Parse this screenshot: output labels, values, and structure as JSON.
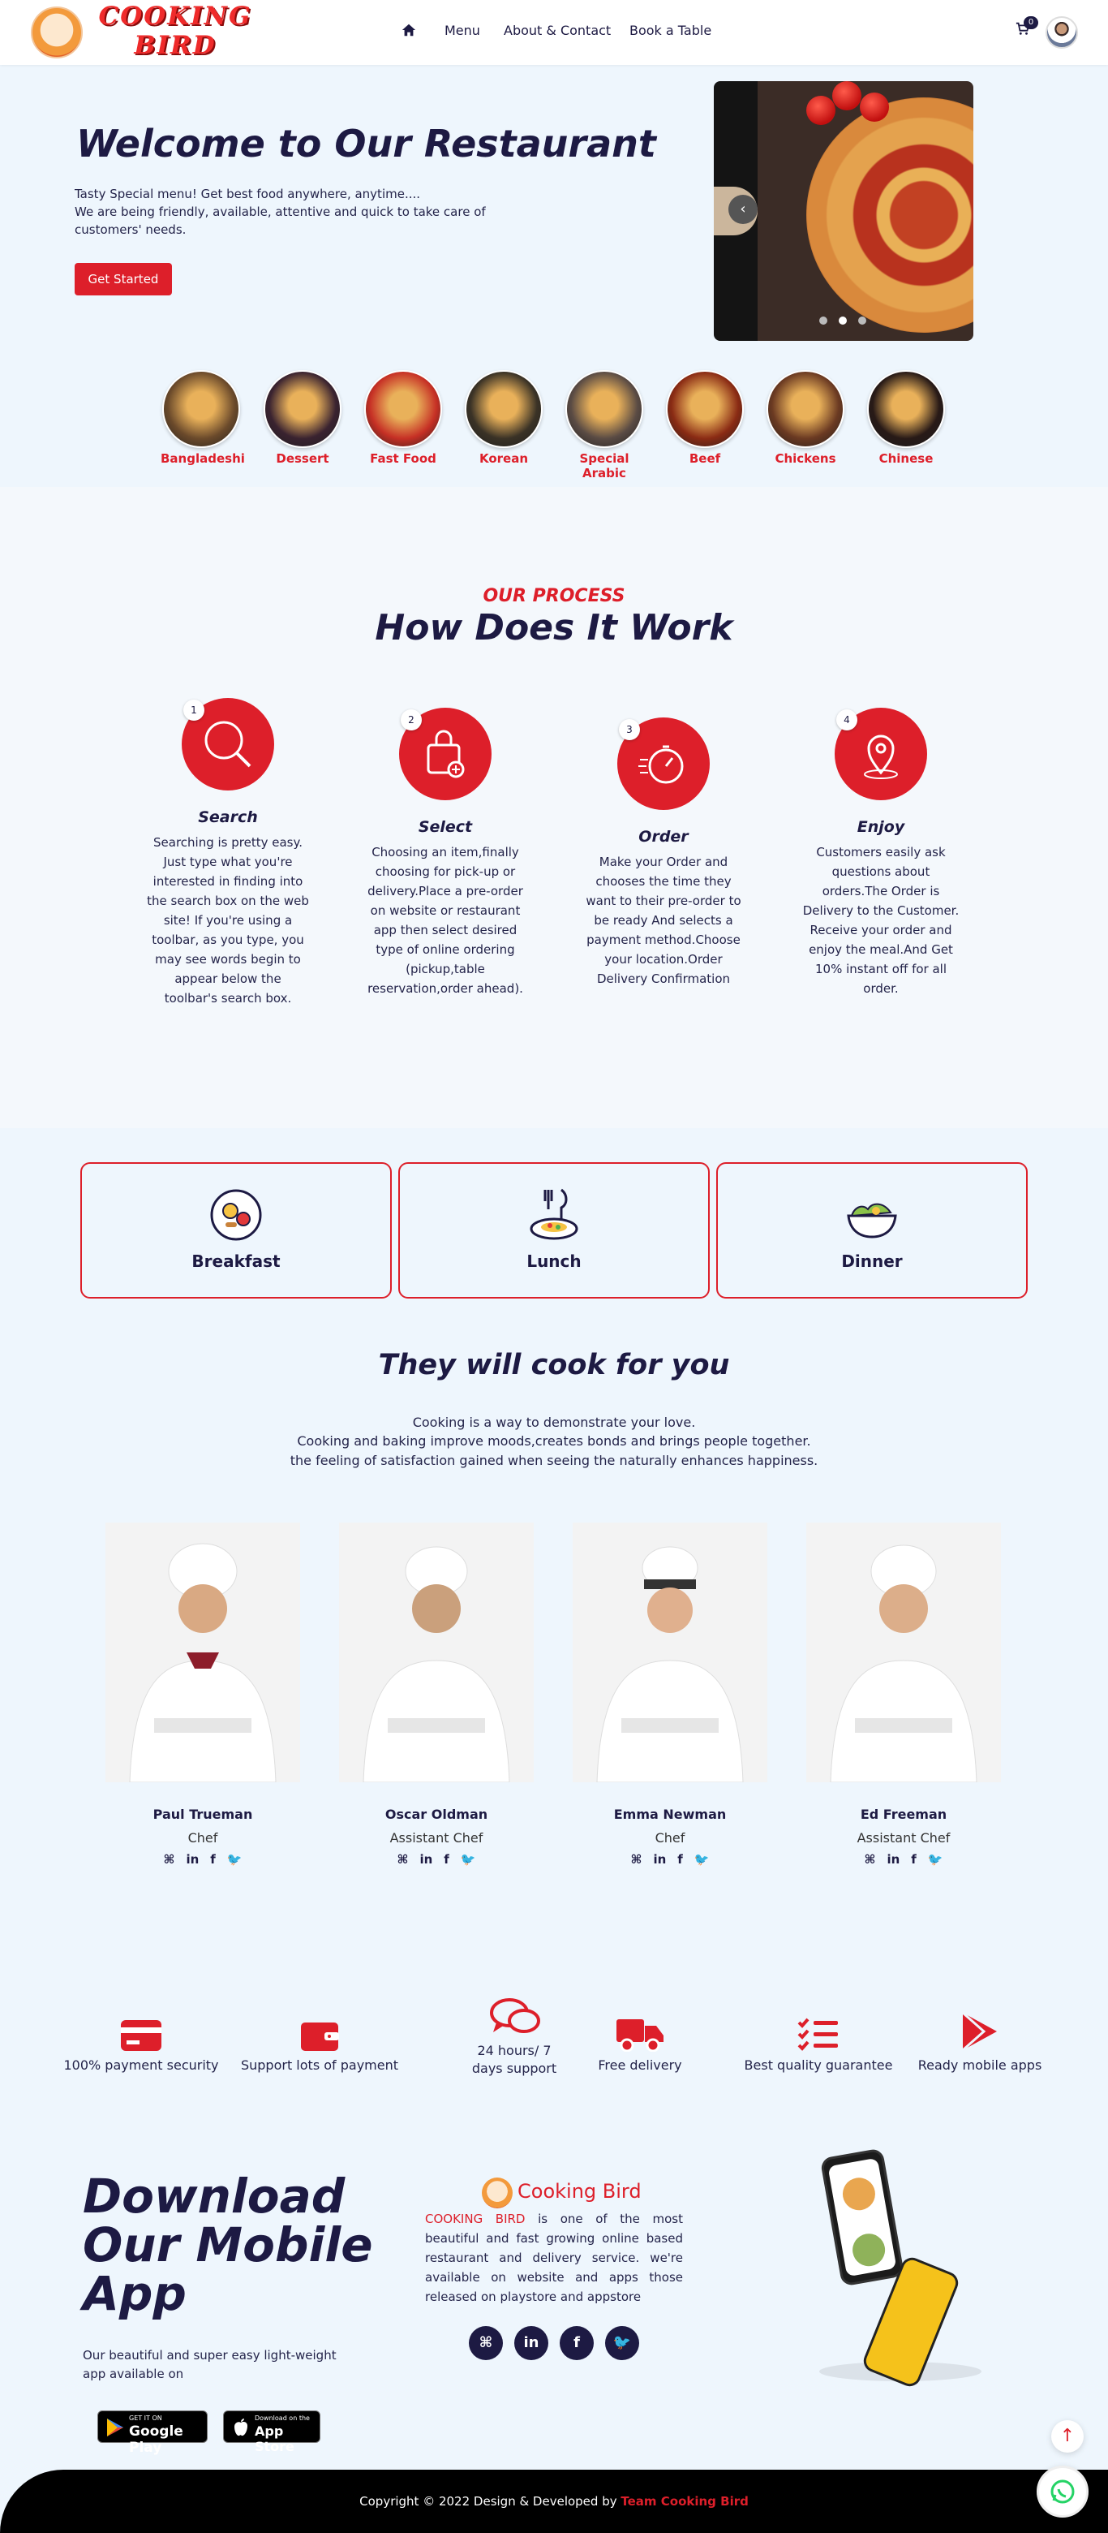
{
  "header": {
    "logo_text_line1": "COOKING",
    "logo_text_line2": "BIRD",
    "nav": [
      {
        "label": "Menu"
      },
      {
        "label": "About & Contact"
      },
      {
        "label": "Book a Table"
      }
    ],
    "cart_count": "0"
  },
  "hero": {
    "title": "Welcome to Our Restaurant",
    "line1": "Tasty Special menu! Get best food anywhere, anytime....",
    "line2": "We are being friendly, available, attentive and quick to take care of",
    "line3": "customers' needs.",
    "cta": "Get Started",
    "slider_prev": "‹"
  },
  "categories": [
    {
      "label": "Bangladeshi",
      "color": "#6b4a2b"
    },
    {
      "label": "Dessert",
      "color": "#3a2330"
    },
    {
      "label": "Fast Food",
      "color": "#c63025"
    },
    {
      "label": "Korean",
      "color": "#3a3226"
    },
    {
      "label": "Special Arabic",
      "color": "#5a4b44"
    },
    {
      "label": "Beef",
      "color": "#8a2b14"
    },
    {
      "label": "Chickens",
      "color": "#6b3a22"
    },
    {
      "label": "Chinese",
      "color": "#281a17"
    }
  ],
  "process": {
    "kicker": "OUR PROCESS",
    "title": "How Does It Work",
    "steps": [
      {
        "num": "1",
        "title": "Search",
        "desc": "Searching is pretty easy. Just type what you're interested in finding into the search box on the web site! If you're using a toolbar, as you type, you may see words begin to appear below the toolbar's search box."
      },
      {
        "num": "2",
        "title": "Select",
        "desc": "Choosing an item,finally choosing for pick-up or delivery.Place a pre-order on website or restaurant app then select desired type of online ordering (pickup,table reservation,order ahead)."
      },
      {
        "num": "3",
        "title": "Order",
        "desc": "Make your Order and chooses the time they want to their pre-order to be ready And selects a payment method.Choose your location.Order Delivery Confirmation"
      },
      {
        "num": "4",
        "title": "Enjoy",
        "desc": "Customers easily ask questions about orders.The Order is Delivery to the Customer. Receive your order and enjoy the meal.And Get 10% instant off for all order."
      }
    ]
  },
  "meals": [
    {
      "label": "Breakfast"
    },
    {
      "label": "Lunch"
    },
    {
      "label": "Dinner"
    }
  ],
  "chefs_section": {
    "title": "They will cook for you",
    "line1": "Cooking is a way to demonstrate your love.",
    "line2": "Cooking and baking improve moods,creates bonds and brings people together.",
    "line3": "the feeling of satisfaction gained when seeing the naturally enhances happiness.",
    "chefs": [
      {
        "name": "Paul Trueman",
        "role": "Chef"
      },
      {
        "name": "Oscar Oldman",
        "role": "Assistant Chef"
      },
      {
        "name": "Emma Newman",
        "role": "Chef"
      },
      {
        "name": "Ed Freeman",
        "role": "Assistant Chef"
      }
    ],
    "social": [
      "⌘",
      "in",
      "f",
      "🐦"
    ]
  },
  "features": [
    {
      "label": "100% payment security",
      "icon": "credit-card-icon"
    },
    {
      "label": "Support lots of payment",
      "icon": "wallet-icon"
    },
    {
      "label": "24 hours/ 7 days support",
      "icon": "chat-icon"
    },
    {
      "label": "Free delivery",
      "icon": "truck-icon"
    },
    {
      "label": "Best quality guarantee",
      "icon": "checklist-icon"
    },
    {
      "label": "Ready mobile apps",
      "icon": "play-icon"
    }
  ],
  "download": {
    "title_l1": "Download",
    "title_l2": "Our Mobile",
    "title_l3": "App",
    "line1": "Our beautiful and super easy light-weight",
    "line2": "app available on",
    "google_small": "GET IT ON",
    "google_big": "Google Play",
    "apple_small": "Download on the",
    "apple_big": "App Store",
    "brand": "Cooking Bird",
    "brand_highlight": "COOKING BIRD",
    "desc": " is one of the most beautiful and fast growing online based restaurant and delivery service. we're available on website and apps those released on playstore and appstore"
  },
  "footer": {
    "copyright": "Copyright © 2022 Design & Developed by ",
    "team": "Team Cooking Bird"
  },
  "colors": {
    "accent": "#dd1f2a",
    "navy": "#1d1a43",
    "background": "#eef6fd"
  }
}
